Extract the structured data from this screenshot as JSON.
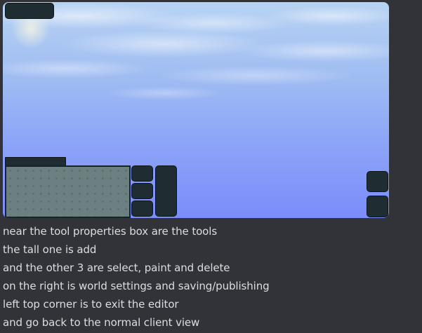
{
  "attachment": {
    "kind": "editor-screenshot"
  },
  "message": {
    "lines": [
      "near the tool properties box are the tools",
      "the tall one is add",
      "and the other 3 are select, paint and delete",
      "on the right is world settings and saving/publishing",
      "left top corner is to exit the editor",
      "and go back to the normal client view"
    ]
  },
  "colors": {
    "background": "#313338",
    "text": "#dbdee1",
    "ui_panel": "#1f2d33",
    "sky_top": "#b7d3f3",
    "sky_bottom": "#7b8cfb"
  }
}
